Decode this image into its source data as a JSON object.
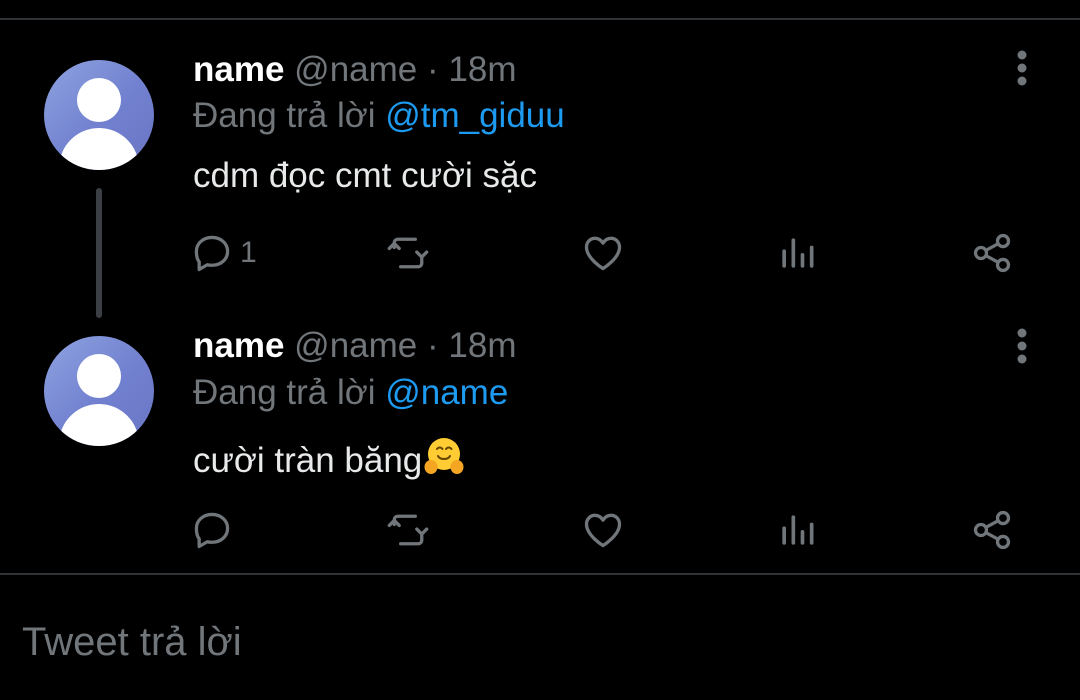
{
  "tweets": [
    {
      "display_name": "name",
      "handle": "@name",
      "separator": "·",
      "time": "18m",
      "reply_prefix": "Đang trả lời",
      "reply_to": "@tm_giduu",
      "text": "cdm đọc cmt cười sặc",
      "emoji": "",
      "reply_count": "1"
    },
    {
      "display_name": "name",
      "handle": "@name",
      "separator": "·",
      "time": "18m",
      "reply_prefix": "Đang trả lời",
      "reply_to": "@name",
      "text": "cười tràn băng",
      "emoji": "hugging-face-emoji",
      "reply_count": ""
    }
  ],
  "compose": {
    "placeholder": "Tweet trả lời"
  },
  "colors": {
    "background": "#000000",
    "muted": "#71767b",
    "mention": "#1d9bf0",
    "divider": "#2f3336"
  }
}
